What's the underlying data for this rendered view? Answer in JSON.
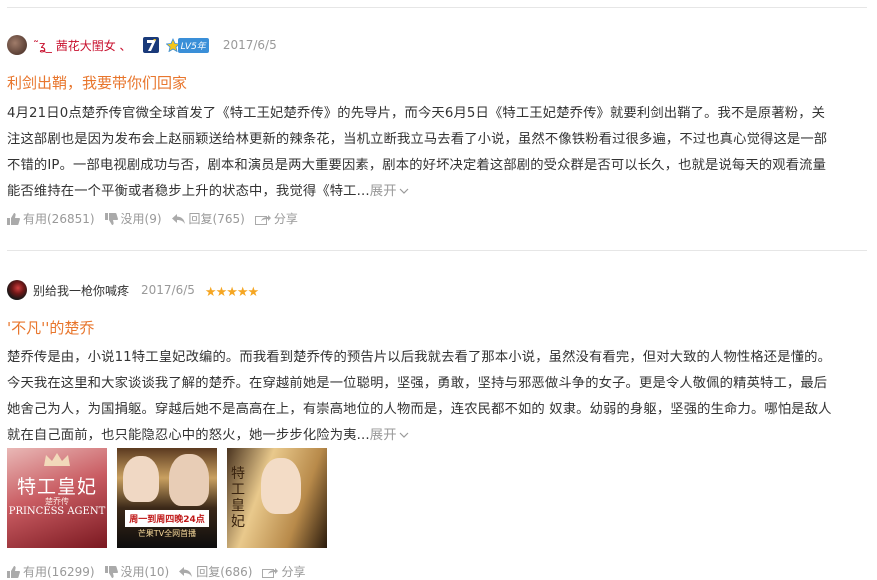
{
  "reviews": [
    {
      "username": "˜ʓ_ 茜花大閨女 、",
      "date": "2017/6/5",
      "badge_level": "LV5年",
      "title": "利剑出鞘，我要带你们回家",
      "lines": [
        "4月21日0点楚乔传官微全球首发了《特工王妃楚乔传》的先导片，而今天6月5日《特工王妃楚乔传》就要利剑出鞘了。我不是原著粉，关",
        "注这部剧也是因为发布会上赵丽颖送给林更新的辣条花，当机立断我立马去看了小说，虽然不像铁粉看过很多遍，不过也真心觉得这是一部",
        "不错的IP。一部电视剧成功与否，剧本和演员是两大重要因素，剧本的好坏决定着这部剧的受众群是否可以长久，也就是说每天的观看流量",
        "能否维持在一个平衡或者稳步上升的状态中，我觉得《特工..."
      ],
      "expand_label": "展开",
      "useful": "有用(26851)",
      "useless": "没用(9)",
      "reply": "回复(765)",
      "share": "分享"
    },
    {
      "username": "别给我一枪你喊疼",
      "date": "2017/6/5",
      "stars": "★★★★★",
      "title": "'不凡''的楚乔",
      "lines": [
        "楚乔传是由，小说11特工皇妃改编的。而我看到楚乔传的预告片以后我就去看了那本小说，虽然没有看完，但对大致的人物性格还是懂的。",
        "今天我在这里和大家谈谈我了解的楚乔。在穿越前她是一位聪明，坚强，勇敢，坚持与邪恶做斗争的女子。更是令人敬佩的精英特工，最后",
        "她舍己为人，为国捐躯。穿越后她不是高高在上，有崇高地位的人物而是，连农民都不如的 奴隶。幼弱的身躯，坚强的生命力。哪怕是敌人",
        "就在自己面前，也只能隐忍心中的怒火，她一步步化险为夷..."
      ],
      "expand_label": "展开",
      "images": [
        {
          "title": "特工皇妃",
          "subtitle": "楚乔传",
          "en": "PRINCESS AGENT"
        },
        {
          "banner": "周一到周四晚24点",
          "banner2": "芒果TV全网首播"
        },
        {
          "title": "特工皇妃"
        }
      ],
      "useful": "有用(16299)",
      "useless": "没用(10)",
      "reply": "回复(686)",
      "share": "分享"
    }
  ],
  "colors": {
    "accent": "#e8762d",
    "username1": "#c8102e",
    "star": "#f5a623",
    "muted": "#999999"
  }
}
